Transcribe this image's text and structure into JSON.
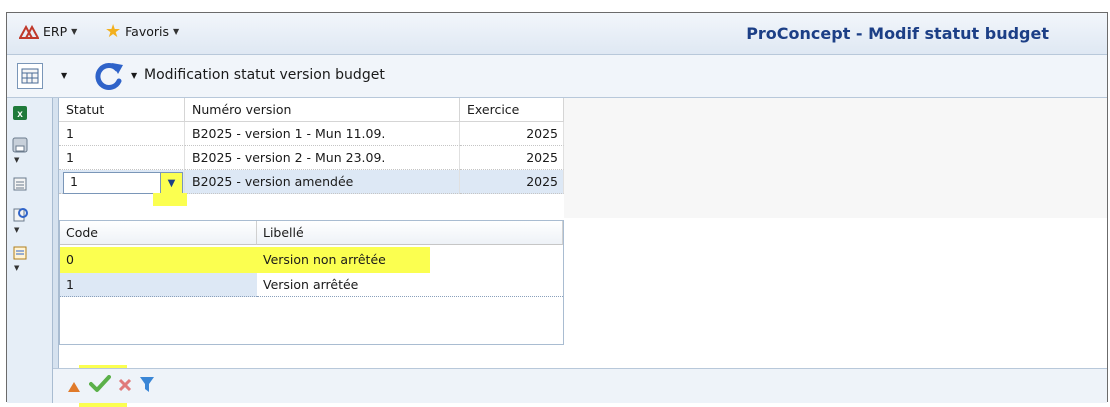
{
  "titlebar": {
    "erp_label": "ERP",
    "favorites_label": "Favoris",
    "app_title": "ProConcept - Modif statut budget"
  },
  "toolbar": {
    "title": "Modification statut version budget"
  },
  "grid": {
    "columns": [
      "Statut",
      "Numéro version",
      "Exercice"
    ],
    "rows": [
      {
        "statut": "1",
        "version": "B2025 - version 1 - Mun 11.09.",
        "exercice": "2025"
      },
      {
        "statut": "1",
        "version": "B2025 - version 2 - Mun 23.09.",
        "exercice": "2025"
      },
      {
        "statut": "1",
        "version": "B2025 - version amendée",
        "exercice": "2025"
      }
    ]
  },
  "dropdown": {
    "columns": [
      "Code",
      "Libellé"
    ],
    "rows": [
      {
        "code": "0",
        "label": "Version non arrêtée"
      },
      {
        "code": "1",
        "label": "Version arrêtée"
      }
    ]
  },
  "colors": {
    "highlight": "#fbff50",
    "title_blue": "#1c3f86",
    "selected_row": "#dde8f5"
  }
}
